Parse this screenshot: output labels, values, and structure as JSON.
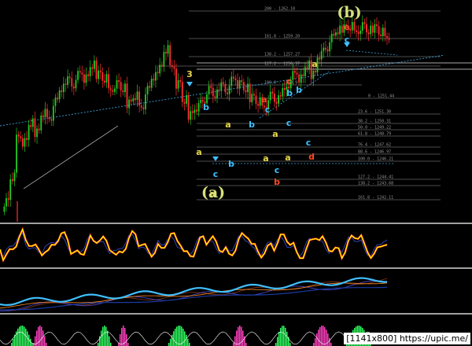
{
  "chart_data": {
    "type": "line",
    "title": "",
    "colors": {
      "background": "#000000",
      "bull_candle": "#22cc22",
      "bear_candle": "#ff3030",
      "trendline": "#3aa0d8",
      "fib_line": "#d8d8d8",
      "label_yellow": "#e8d84a",
      "label_red": "#ff4a20",
      "label_cyan": "#40c0ff",
      "label_green_big": "#d6e07a",
      "osc_yellow": "#ffff00",
      "osc_red": "#ff2020",
      "osc_blue": "#4060ff",
      "cyan_line": "#40c0ff",
      "hist_magenta": "#ff40c0",
      "hist_green": "#30ff60"
    },
    "fib_levels": [
      {
        "text": "200 - 1262.10",
        "price": 1262.1
      },
      {
        "text": "161.8 - 1259.20",
        "price": 1259.2
      },
      {
        "text": "138.2 - 1257.27",
        "price": 1257.27
      },
      {
        "text": "127.2 - 1256.37",
        "price": 1256.37
      },
      {
        "text": "100.0 - 1253.9",
        "price": 1253.9
      },
      {
        "text": "0 - 1251.44",
        "price": 1251.44
      },
      {
        "text": "23.6 - 1251.30",
        "price": 1251.3
      },
      {
        "text": "38.2 - 1250.31",
        "price": 1250.31
      },
      {
        "text": "50.0 - 1249.22",
        "price": 1249.22
      },
      {
        "text": "61.8 - 1248.79",
        "price": 1248.79
      },
      {
        "text": "76.4 - 1247.62",
        "price": 1247.62
      },
      {
        "text": "88.6 - 1246.97",
        "price": 1246.97
      },
      {
        "text": "100.0 - 1246.21",
        "price": 1246.21
      },
      {
        "text": "127.2 - 1244.41",
        "price": 1244.41
      },
      {
        "text": "138.2 - 1243.68",
        "price": 1243.68
      },
      {
        "text": "161.8 - 1242.11",
        "price": 1242.11
      }
    ],
    "close_series": [
      1230,
      1234,
      1241,
      1240,
      1243,
      1242,
      1245,
      1244,
      1247,
      1249,
      1251,
      1250,
      1252,
      1251,
      1253,
      1252,
      1251,
      1249,
      1250,
      1249,
      1247,
      1248,
      1246,
      1249,
      1251,
      1253,
      1256,
      1253,
      1250,
      1247,
      1245,
      1246,
      1247,
      1249,
      1248,
      1250,
      1249,
      1251,
      1250,
      1249,
      1248,
      1247,
      1246,
      1248,
      1247,
      1249,
      1250,
      1252,
      1251,
      1253,
      1252,
      1255,
      1256,
      1258,
      1259,
      1260,
      1260,
      1259,
      1260,
      1259,
      1260,
      1259,
      1258
    ],
    "wave_labels": [
      {
        "text": "3",
        "color": "label_yellow",
        "big": false
      },
      {
        "text": "a",
        "color": "label_yellow",
        "big": false
      },
      {
        "text": "b",
        "color": "label_cyan",
        "big": false
      },
      {
        "text": "a",
        "color": "label_yellow",
        "big": false
      },
      {
        "text": "c",
        "color": "label_cyan",
        "big": false
      },
      {
        "text": "b",
        "color": "label_cyan",
        "big": false
      },
      {
        "text": "a",
        "color": "label_yellow",
        "big": false
      },
      {
        "text": "a",
        "color": "label_red",
        "big": false
      },
      {
        "text": "b",
        "color": "label_cyan",
        "big": false
      },
      {
        "text": "c",
        "color": "label_red",
        "big": false
      },
      {
        "text": "a",
        "color": "label_yellow",
        "big": false
      },
      {
        "text": "c",
        "color": "label_cyan",
        "big": false
      },
      {
        "text": "a",
        "color": "label_yellow",
        "big": false
      },
      {
        "text": "c",
        "color": "label_cyan",
        "big": false
      },
      {
        "text": "b",
        "color": "label_red",
        "big": false
      },
      {
        "text": "b",
        "color": "label_cyan",
        "big": false
      },
      {
        "text": "b",
        "color": "label_cyan",
        "big": false
      },
      {
        "text": "a",
        "color": "label_yellow",
        "big": false
      },
      {
        "text": "c",
        "color": "label_cyan",
        "big": false
      },
      {
        "text": "a",
        "color": "label_yellow",
        "big": false
      },
      {
        "text": "c",
        "color": "label_cyan",
        "big": false
      },
      {
        "text": "d",
        "color": "label_red",
        "big": false
      },
      {
        "text": "c",
        "color": "label_cyan",
        "big": false
      },
      {
        "text": "e",
        "color": "label_red",
        "big": false
      },
      {
        "text": "(a)",
        "color": "label_green_big",
        "big": true
      },
      {
        "text": "(b)",
        "color": "label_green_big",
        "big": true
      }
    ],
    "watermark": "[1141x800] https://upic.me/"
  }
}
